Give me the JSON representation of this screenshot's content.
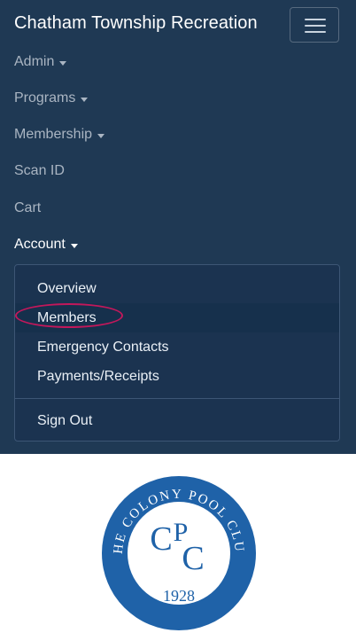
{
  "navbar": {
    "brand": "Chatham Township Recreation",
    "toggler_icon": "hamburger-icon",
    "items": [
      {
        "label": "Admin",
        "dropdown": true
      },
      {
        "label": "Programs",
        "dropdown": true
      },
      {
        "label": "Membership",
        "dropdown": true
      },
      {
        "label": "Scan ID",
        "dropdown": false
      },
      {
        "label": "Cart",
        "dropdown": false
      },
      {
        "label": "Account",
        "dropdown": true,
        "active": true
      }
    ]
  },
  "account_menu": {
    "items": [
      "Overview",
      "Members",
      "Emergency Contacts",
      "Payments/Receipts"
    ],
    "sign_out": "Sign Out",
    "highlighted": "Members"
  },
  "logo": {
    "top_text": "THE COLONY POOL CLUB",
    "monogram": [
      "C",
      "P",
      "C"
    ],
    "year": "1928"
  },
  "colors": {
    "navbar_bg": "#1f3954",
    "annotation": "#c2185b",
    "logo_blue": "#1f62a8"
  }
}
